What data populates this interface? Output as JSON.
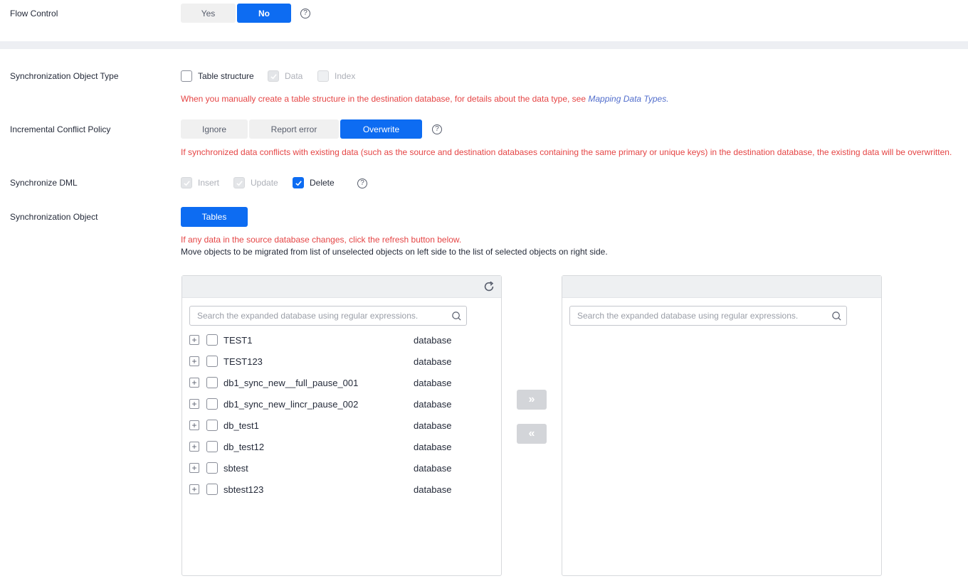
{
  "flow_control": {
    "label": "Flow Control",
    "options": [
      "Yes",
      "No"
    ],
    "selected": "No",
    "help": "?"
  },
  "sync_object_type": {
    "label": "Synchronization Object Type",
    "options": [
      {
        "label": "Table structure",
        "checked": false,
        "disabled": false
      },
      {
        "label": "Data",
        "checked": true,
        "disabled": true
      },
      {
        "label": "Index",
        "checked": false,
        "disabled": true
      }
    ],
    "warning": "When you manually create a table structure in the destination database, for details about the data type, see ",
    "warning_link": "Mapping Data Types."
  },
  "conflict_policy": {
    "label": "Incremental Conflict Policy",
    "options": [
      "Ignore",
      "Report error",
      "Overwrite"
    ],
    "selected": "Overwrite",
    "help": "?",
    "warning": "If synchronized data conflicts with existing data (such as the source and destination databases containing the same primary or unique keys) in the destination database, the existing data will be overwritten."
  },
  "sync_dml": {
    "label": "Synchronize DML",
    "options": [
      {
        "label": "Insert",
        "checked": true,
        "disabled": true
      },
      {
        "label": "Update",
        "checked": true,
        "disabled": true
      },
      {
        "label": "Delete",
        "checked": true,
        "disabled": false
      }
    ],
    "help": "?"
  },
  "sync_object": {
    "label": "Synchronization Object",
    "button": "Tables",
    "warning": "If any data in the source database changes, click the refresh button below.",
    "note": "Move objects to be migrated from list of unselected objects on left side to the list of selected objects on right side."
  },
  "left_panel": {
    "search_placeholder": "Search the expanded database using regular expressions.",
    "expand_glyph": "+",
    "items": [
      {
        "name": "TEST1",
        "type": "database"
      },
      {
        "name": "TEST123",
        "type": "database"
      },
      {
        "name": "db1_sync_new__full_pause_001",
        "type": "database"
      },
      {
        "name": "db1_sync_new_lincr_pause_002",
        "type": "database"
      },
      {
        "name": "db_test1",
        "type": "database"
      },
      {
        "name": "db_test12",
        "type": "database"
      },
      {
        "name": "sbtest",
        "type": "database"
      },
      {
        "name": "sbtest123",
        "type": "database"
      }
    ]
  },
  "right_panel": {
    "search_placeholder": "Search the expanded database using regular expressions."
  },
  "transfer": {
    "move_right": "»",
    "move_left": "«"
  },
  "colors": {
    "primary": "#0d6cf2",
    "warning": "#e54545",
    "link": "#526ecc"
  }
}
